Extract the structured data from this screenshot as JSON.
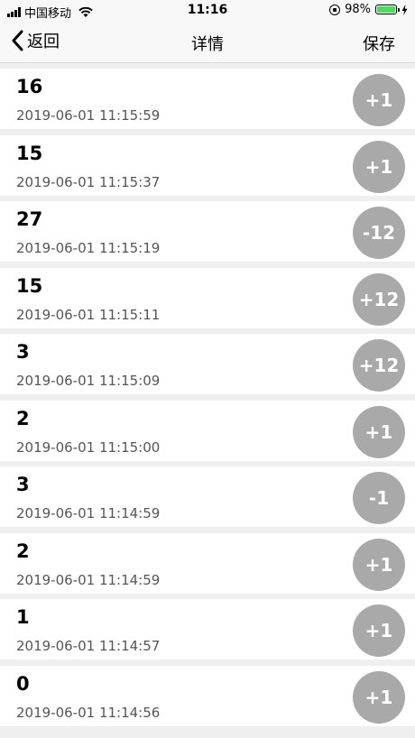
{
  "status_bar": {
    "carrier": "中国移动",
    "time": "11:16",
    "battery": "98%",
    "battery_level": 0.98,
    "battery_color": "#4cd964"
  },
  "nav": {
    "back_label": "返回",
    "title": "详情",
    "save_label": "保存"
  },
  "items": [
    {
      "value": "16",
      "time": "2019-06-01 11:15:59",
      "delta": "+1"
    },
    {
      "value": "15",
      "time": "2019-06-01 11:15:37",
      "delta": "+1"
    },
    {
      "value": "27",
      "time": "2019-06-01 11:15:19",
      "delta": "-12"
    },
    {
      "value": "15",
      "time": "2019-06-01 11:15:11",
      "delta": "+12"
    },
    {
      "value": "3",
      "time": "2019-06-01 11:15:09",
      "delta": "+12"
    },
    {
      "value": "2",
      "time": "2019-06-01 11:15:00",
      "delta": "+1"
    },
    {
      "value": "3",
      "time": "2019-06-01 11:14:59",
      "delta": "-1"
    },
    {
      "value": "2",
      "time": "2019-06-01 11:14:59",
      "delta": "+1"
    },
    {
      "value": "1",
      "time": "2019-06-01 11:14:57",
      "delta": "+1"
    },
    {
      "value": "0",
      "time": "2019-06-01 11:14:56",
      "delta": "+1"
    }
  ]
}
